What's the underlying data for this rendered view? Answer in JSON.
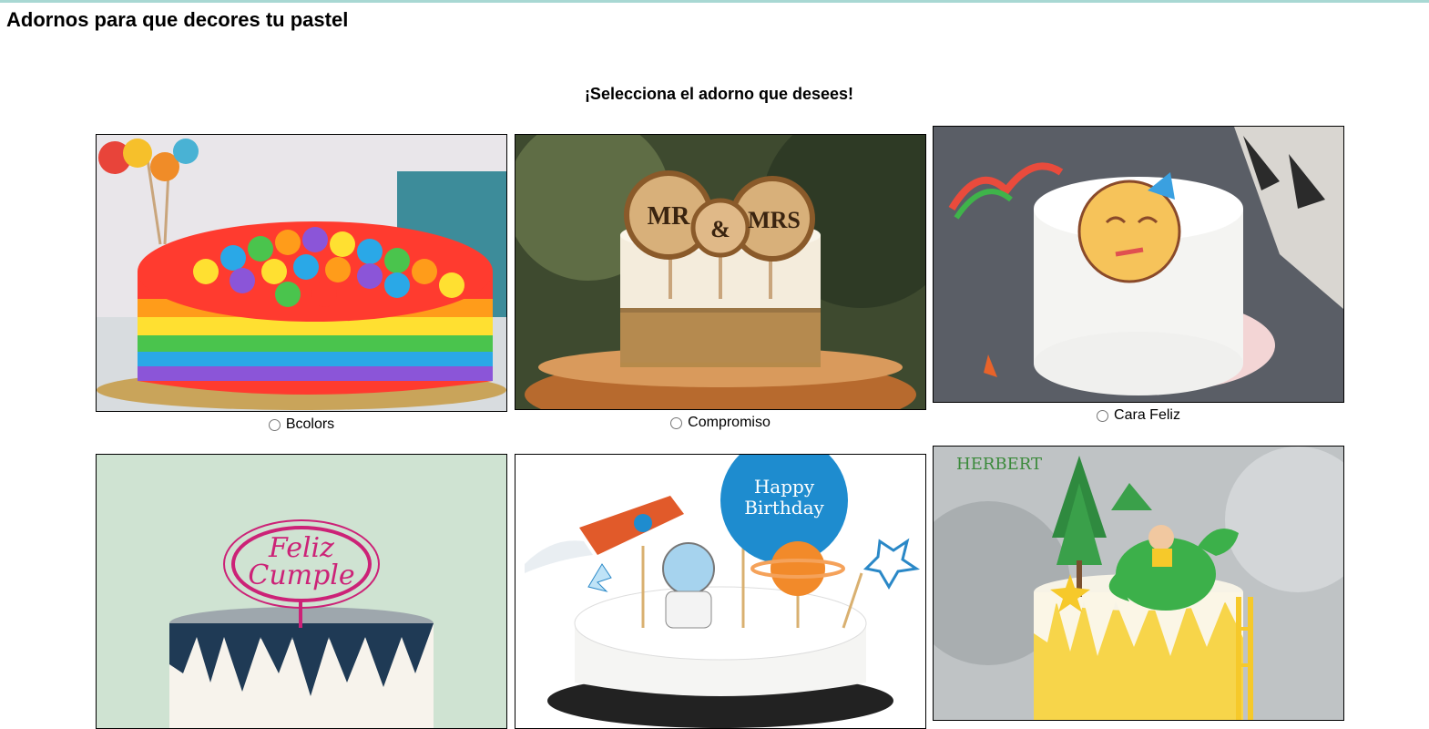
{
  "page": {
    "title": "Adornos para que decores tu pastel",
    "subtitle": "¡Selecciona el adorno que desees!"
  },
  "options": [
    {
      "label": "Bcolors",
      "image": "rainbow-cake-icon"
    },
    {
      "label": "Compromiso",
      "image": "mr-mrs-cake-icon",
      "topper_left": "MR",
      "topper_mid": "&",
      "topper_right": "MRS"
    },
    {
      "label": "Cara Feliz",
      "image": "smiley-cake-icon"
    },
    {
      "label": "",
      "image": "feliz-cumple-cake-icon",
      "topper_line1": "Feliz",
      "topper_line2": "Cumple"
    },
    {
      "label": "",
      "image": "happy-birthday-space-cake-icon",
      "topper_line1": "Happy",
      "topper_line2": "Birthday"
    },
    {
      "label": "",
      "image": "dinosaur-cake-icon",
      "watermark": "HERBERT"
    }
  ]
}
